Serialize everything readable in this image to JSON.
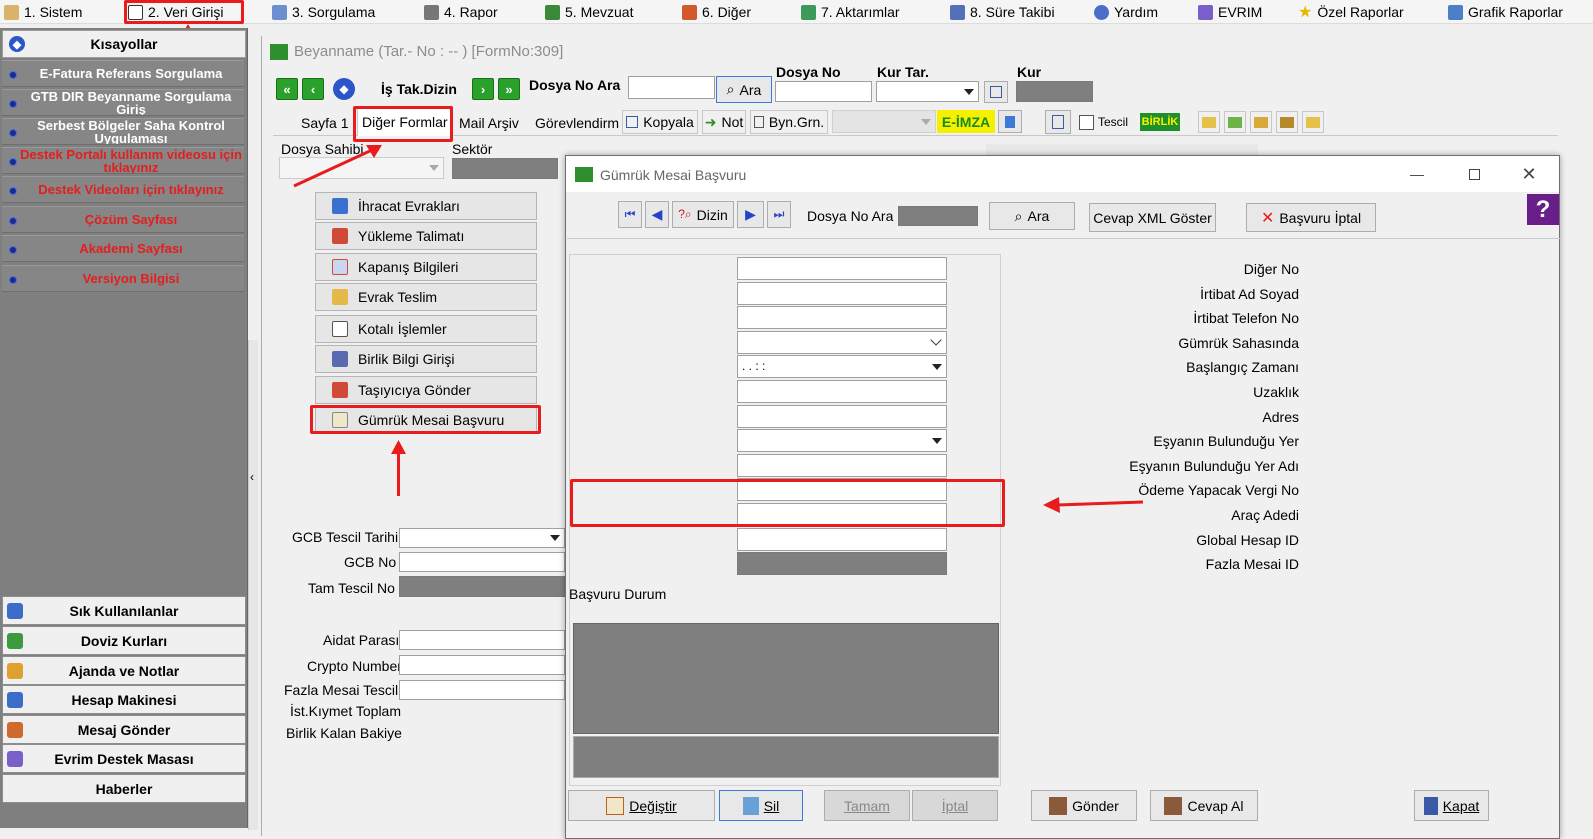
{
  "menu": {
    "items": [
      {
        "label": "1.  Sistem"
      },
      {
        "label": "2.  Veri Girişi"
      },
      {
        "label": "3.  Sorgulama"
      },
      {
        "label": "4.  Rapor"
      },
      {
        "label": "5.  Mevzuat"
      },
      {
        "label": "6.  Diğer"
      },
      {
        "label": "7.  Aktarımlar"
      },
      {
        "label": "8. Süre Takibi"
      },
      {
        "label": "Yardım"
      },
      {
        "label": "EVRIM"
      },
      {
        "label": "Özel Raporlar"
      },
      {
        "label": "Grafik Raporlar"
      }
    ]
  },
  "sidebar": {
    "header": "Kısayollar",
    "items": [
      {
        "label": "E-Fatura Referans Sorgulama",
        "color": "#ffffff"
      },
      {
        "label": "GTB DIR Beyanname Sorgulama Giriş",
        "color": "#ffffff"
      },
      {
        "label": "Serbest Bölgeler Saha Kontrol Uygulaması",
        "color": "#ffffff"
      },
      {
        "label": "Destek Portalı kullanım videosu için tıklayınız",
        "color": "#e41e1e"
      },
      {
        "label": "Destek Videoları için tıklayınız",
        "color": "#e41e1e"
      },
      {
        "label": "Çözüm Sayfası",
        "color": "#e41e1e"
      },
      {
        "label": "Akademi Sayfası",
        "color": "#e41e1e"
      },
      {
        "label": "Versiyon Bilgisi",
        "color": "#e41e1e"
      }
    ],
    "bottom": [
      {
        "label": "Sık Kullanılanlar"
      },
      {
        "label": "Doviz Kurları"
      },
      {
        "label": "Ajanda ve Notlar"
      },
      {
        "label": "Hesap Makinesi"
      },
      {
        "label": "Mesaj Gönder"
      },
      {
        "label": "Evrim Destek Masası"
      },
      {
        "label": "Haberler"
      }
    ]
  },
  "main": {
    "title": "Beyanname (Tar.- No :  --  )  [FormNo:309]",
    "toolbar": {
      "is_tak_dizin": "İş Tak.Dizin",
      "dosya_no_ara": "Dosya No Ara",
      "ara": "Ara",
      "dosya_no": "Dosya No",
      "kur_tar": "Kur Tar.",
      "kur": "Kur"
    },
    "tabs": {
      "sayfa1": "Sayfa 1",
      "diger_formlar": "Diğer Formlar",
      "mail_arsiv": "Mail Arşiv",
      "gorevlendirm": "Görevlendirm",
      "kopyala": "Kopyala",
      "not": "Not",
      "byn_grn": "Byn.Grn.",
      "e_imza": "E-İMZA",
      "tescil": "Tescil",
      "birlik": "BİRLİK"
    },
    "dosya_sahibi": "Dosya Sahibi",
    "sektor": "Sektör",
    "forms": [
      {
        "label": "İhracat Evrakları"
      },
      {
        "label": "Yükleme Talimatı"
      },
      {
        "label": "Kapanış Bilgileri"
      },
      {
        "label": "Evrak Teslim"
      },
      {
        "label": "Kotalı İşlemler"
      },
      {
        "label": "Birlik Bilgi Girişi"
      },
      {
        "label": "Taşıyıcıya Gönder"
      },
      {
        "label": "Gümrük Mesai Başvuru"
      }
    ],
    "lower_fields": {
      "gcb_tescil_tarihi": "GCB Tescil Tarihi",
      "gcb_no": "GCB No",
      "tam_tescil_no": "Tam Tescil No",
      "aidat_parasi": "Aidat Parası",
      "crypto_number": "Crypto Number",
      "fazla_mesai_tescil": "Fazla Mesai Tescil",
      "ist_kiymet_toplam": "İst.Kıymet Toplam",
      "birlik_kalan_bakiye": "Birlik Kalan Bakiye"
    }
  },
  "dialog": {
    "title": "Gümrük Mesai Başvuru",
    "toolbar": {
      "dizin": "Dizin",
      "dosya_no_ara": "Dosya No Ara",
      "ara": "Ara",
      "cevap_xml": "Cevap XML Göster",
      "basvuru_iptal": "Başvuru İptal"
    },
    "fields": [
      {
        "label": "Diğer No",
        "type": "text",
        "value": ""
      },
      {
        "label": "İrtibat Ad Soyad",
        "type": "text",
        "value": ""
      },
      {
        "label": "İrtibat Telefon No",
        "type": "text",
        "value": ""
      },
      {
        "label": "Gümrük Sahasında",
        "type": "combo-light",
        "value": ""
      },
      {
        "label": "Başlangıç Zamanı",
        "type": "combo",
        "value": " .   .        :  :"
      },
      {
        "label": "Uzaklık",
        "type": "text",
        "value": ""
      },
      {
        "label": "Adres",
        "type": "text",
        "value": ""
      },
      {
        "label": "Eşyanın Bulunduğu Yer",
        "type": "combo",
        "value": ""
      },
      {
        "label": "Eşyanın Bulunduğu Yer Adı",
        "type": "text",
        "value": ""
      },
      {
        "label": "Ödeme Yapacak Vergi No",
        "type": "text",
        "value": ""
      },
      {
        "label": "Araç Adedi",
        "type": "text",
        "value": ""
      },
      {
        "label": "Global Hesap ID",
        "type": "text",
        "value": ""
      },
      {
        "label": "Fazla Mesai ID",
        "type": "gray",
        "value": ""
      }
    ],
    "basvuru_durum": "Başvuru Durum",
    "buttons": {
      "degistir": "Değiştir",
      "sil": "Sil",
      "tamam": "Tamam",
      "iptal": "İptal",
      "gonder": "Gönder",
      "cevap_al": "Cevap Al",
      "kapat": "Kapat"
    }
  },
  "colors": {
    "annotation_red": "#e81c1c",
    "sidebar_gray": "#7f7f7f",
    "e_imza_bg": "#f5f000",
    "birlik_bg": "#1f8f2a"
  }
}
